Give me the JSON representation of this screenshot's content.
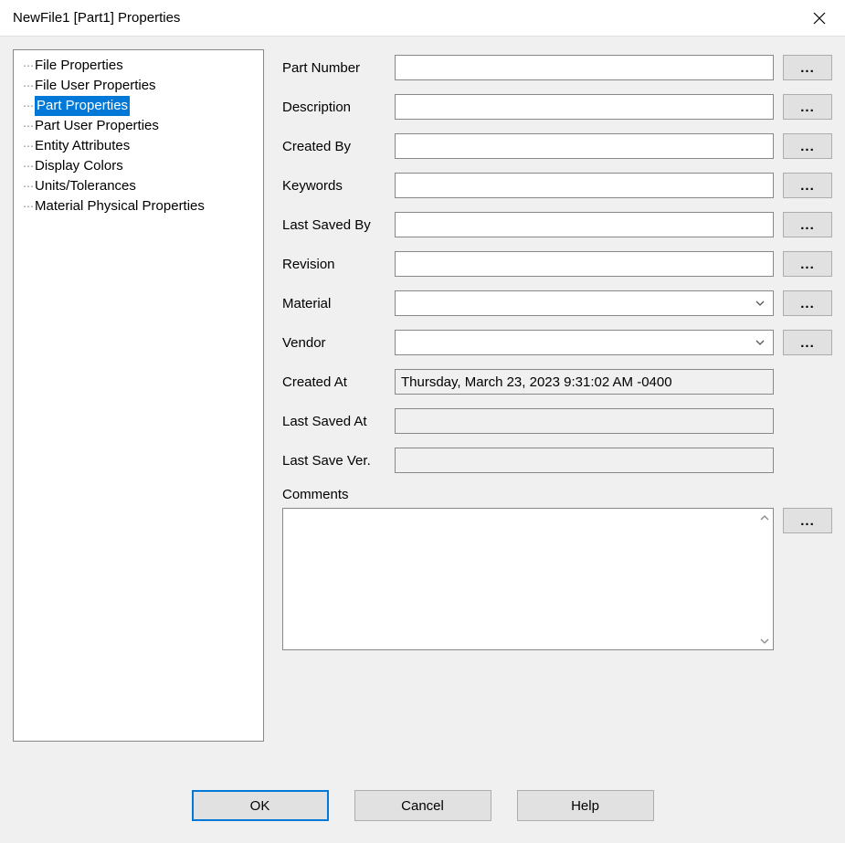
{
  "titlebar": {
    "title": "NewFile1 [Part1] Properties"
  },
  "tree": {
    "items": [
      {
        "label": "File Properties",
        "selected": false
      },
      {
        "label": "File User Properties",
        "selected": false
      },
      {
        "label": "Part Properties",
        "selected": true
      },
      {
        "label": "Part User Properties",
        "selected": false
      },
      {
        "label": "Entity Attributes",
        "selected": false
      },
      {
        "label": "Display Colors",
        "selected": false
      },
      {
        "label": "Units/Tolerances",
        "selected": false
      },
      {
        "label": "Material Physical Properties",
        "selected": false
      }
    ]
  },
  "form": {
    "part_number": {
      "label": "Part Number",
      "value": ""
    },
    "description": {
      "label": "Description",
      "value": ""
    },
    "created_by": {
      "label": "Created By",
      "value": ""
    },
    "keywords": {
      "label": "Keywords",
      "value": ""
    },
    "last_saved_by": {
      "label": "Last Saved By",
      "value": ""
    },
    "revision": {
      "label": "Revision",
      "value": ""
    },
    "material": {
      "label": "Material",
      "value": ""
    },
    "vendor": {
      "label": "Vendor",
      "value": ""
    },
    "created_at": {
      "label": "Created At",
      "value": "Thursday, March 23, 2023 9:31:02 AM -0400"
    },
    "last_saved_at": {
      "label": "Last Saved At",
      "value": ""
    },
    "last_save_ver": {
      "label": "Last Save Ver.",
      "value": ""
    },
    "comments": {
      "label": "Comments",
      "value": ""
    },
    "ellipsis": "..."
  },
  "buttons": {
    "ok": "OK",
    "cancel": "Cancel",
    "help": "Help"
  }
}
